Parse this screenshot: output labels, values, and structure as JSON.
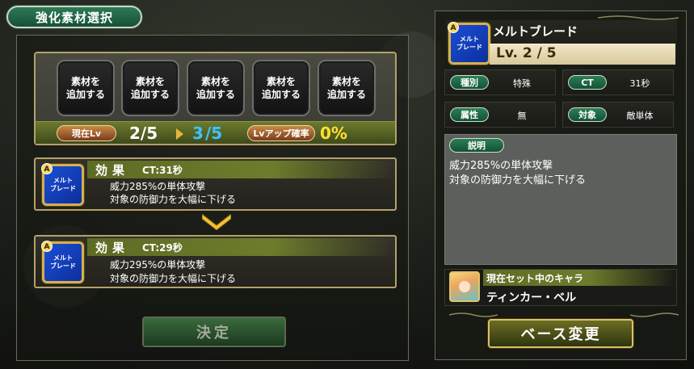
{
  "title": "強化素材選択",
  "material_slots": [
    {
      "line1": "素材を",
      "line2": "追加する"
    },
    {
      "line1": "素材を",
      "line2": "追加する"
    },
    {
      "line1": "素材を",
      "line2": "追加する"
    },
    {
      "line1": "素材を",
      "line2": "追加する"
    },
    {
      "line1": "素材を",
      "line2": "追加する"
    }
  ],
  "level_bar": {
    "current_label": "現在Lv",
    "current_value": "2/5",
    "next_num": "3",
    "next_max": "/5",
    "rate_label": "Lvアップ確率",
    "rate_value": "0%"
  },
  "effect_before": {
    "badge": "A",
    "icon_line1": "メルト",
    "icon_line2": "ブレード",
    "label": "効果",
    "ct": "CT:31秒",
    "line1": "威力285%の単体攻撃",
    "line2": "対象の防御力を大幅に下げる"
  },
  "effect_after": {
    "badge": "A",
    "icon_line1": "メルト",
    "icon_line2": "ブレード",
    "label": "効果",
    "ct": "CT:29秒",
    "line1": "威力295%の単体攻撃",
    "line2": "対象の防御力を大幅に下げる"
  },
  "decide_label": "決定",
  "detail": {
    "badge": "A",
    "icon_line1": "メルト",
    "icon_line2": "ブレード",
    "name": "メルトブレード",
    "level": "Lv. 2 / 5",
    "stats": [
      {
        "label": "種別",
        "value": "特殊"
      },
      {
        "label": "CT",
        "value": "31秒"
      },
      {
        "label": "属性",
        "value": "無"
      },
      {
        "label": "対象",
        "value": "敵単体"
      }
    ],
    "desc_label": "説明",
    "desc_line1": "威力285%の単体攻撃",
    "desc_line2": "対象の防御力を大幅に下げる",
    "chara_heading": "現在セット中のキャラ",
    "chara_name": "ティンカー・ベル",
    "base_change_label": "ベース変更"
  },
  "colors": {
    "accent_blue": "#3cc4ff",
    "accent_yellow": "#ffe12e",
    "frame_gold": "#b5a16a",
    "tag_green": "#2c7e55"
  }
}
